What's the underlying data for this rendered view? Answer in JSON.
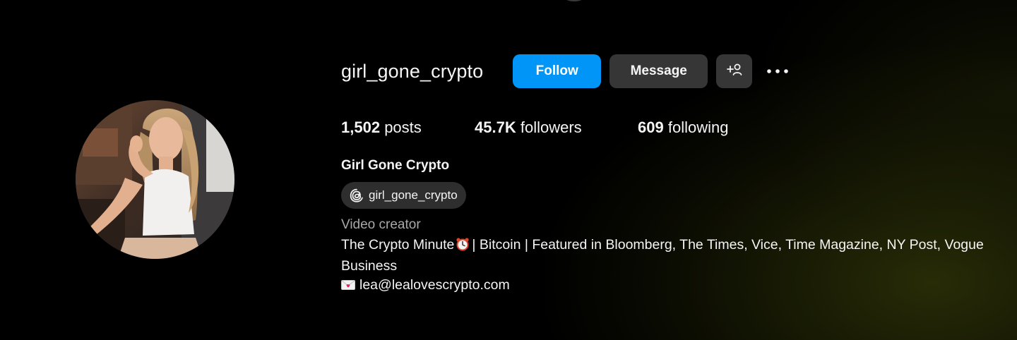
{
  "profile": {
    "username": "girl_gone_crypto",
    "full_name": "Girl Gone Crypto",
    "threads_handle": "girl_gone_crypto",
    "category": "Video creator",
    "bio": {
      "line1_before": "The Crypto Minute",
      "line1_after": "| Bitcoin | Featured in Bloomberg, The Times, Vice, Time Magazine, NY Post, Vogue Business",
      "contact_email": "lea@lealovescrypto.com"
    }
  },
  "actions": {
    "follow_label": "Follow",
    "message_label": "Message",
    "suggest_icon": "add-person-icon",
    "more_icon": "more-horizontal-icon"
  },
  "stats": {
    "posts_count": "1,502",
    "posts_label": "posts",
    "followers_count": "45.7K",
    "followers_label": "followers",
    "following_count": "609",
    "following_label": "following"
  },
  "colors": {
    "follow_button": "#0095f6",
    "secondary_button": "#363636",
    "background": "#000000",
    "muted_text": "#a8a8a8"
  },
  "icons": {
    "threads": "threads-icon",
    "clock_emoji": "alarm-clock-emoji",
    "mail_emoji": "love-letter-emoji"
  }
}
